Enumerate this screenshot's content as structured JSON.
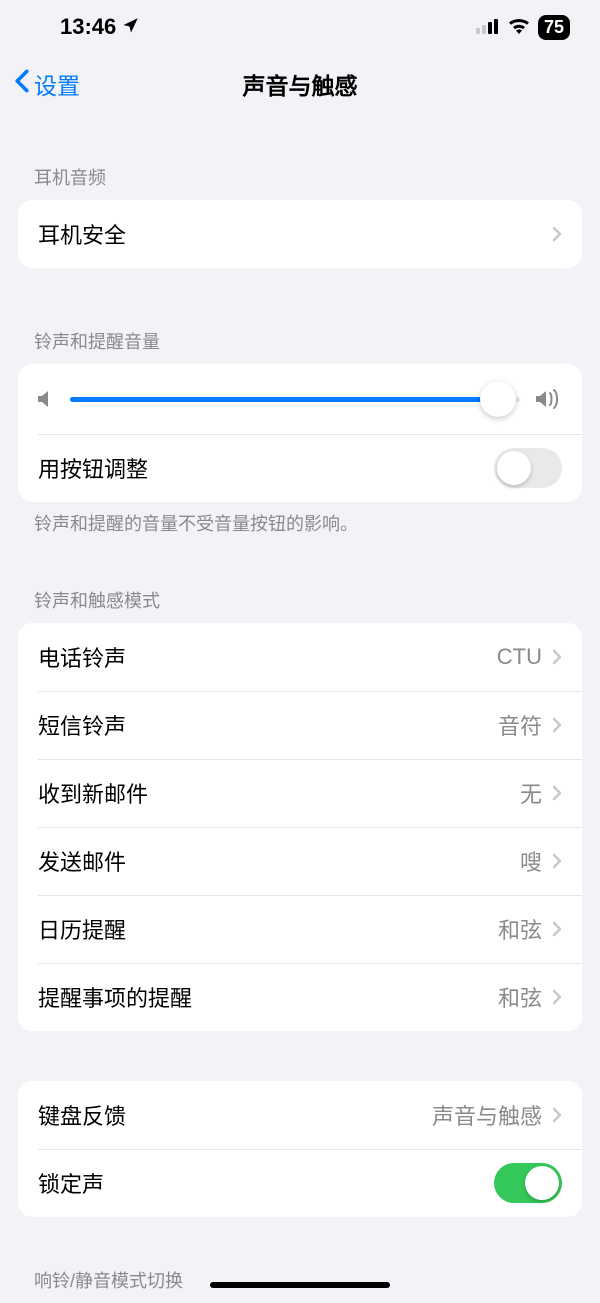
{
  "status": {
    "time": "13:46",
    "battery": "75"
  },
  "nav": {
    "back": "设置",
    "title": "声音与触感"
  },
  "sections": {
    "headphone": {
      "header": "耳机音频",
      "safety": "耳机安全"
    },
    "volume": {
      "header": "铃声和提醒音量",
      "slider_value": 95,
      "button_adjust": "用按钮调整",
      "button_adjust_on": false,
      "footer": "铃声和提醒的音量不受音量按钮的影响。"
    },
    "patterns": {
      "header": "铃声和触感模式",
      "items": [
        {
          "label": "电话铃声",
          "value": "CTU"
        },
        {
          "label": "短信铃声",
          "value": "音符"
        },
        {
          "label": "收到新邮件",
          "value": "无"
        },
        {
          "label": "发送邮件",
          "value": "嗖"
        },
        {
          "label": "日历提醒",
          "value": "和弦"
        },
        {
          "label": "提醒事项的提醒",
          "value": "和弦"
        }
      ]
    },
    "keyboard": {
      "feedback_label": "键盘反馈",
      "feedback_value": "声音与触感",
      "lock_label": "锁定声",
      "lock_on": true
    },
    "silent": {
      "header": "响铃/静音模式切换"
    }
  }
}
